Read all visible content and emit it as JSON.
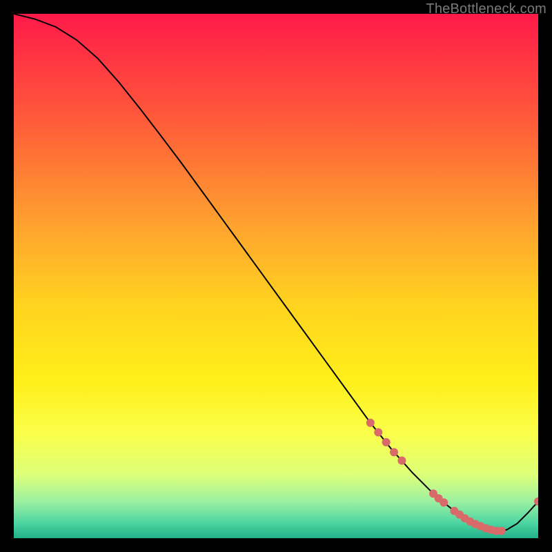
{
  "watermark": "TheBottleneck.com",
  "chart_data": {
    "type": "line",
    "title": "",
    "xlabel": "",
    "ylabel": "",
    "xlim": [
      0,
      100
    ],
    "ylim": [
      0,
      100
    ],
    "grid": false,
    "legend": false,
    "background_gradient": {
      "stops": [
        {
          "offset": 0.0,
          "color": "#ff1a49"
        },
        {
          "offset": 0.2,
          "color": "#ff5a3a"
        },
        {
          "offset": 0.4,
          "color": "#ffa12e"
        },
        {
          "offset": 0.55,
          "color": "#ffd21f"
        },
        {
          "offset": 0.7,
          "color": "#ffef1a"
        },
        {
          "offset": 0.8,
          "color": "#fbff4a"
        },
        {
          "offset": 0.88,
          "color": "#dcff7a"
        },
        {
          "offset": 0.93,
          "color": "#9cf0a0"
        },
        {
          "offset": 0.97,
          "color": "#4fd6a2"
        },
        {
          "offset": 1.0,
          "color": "#21b08a"
        }
      ]
    },
    "series": [
      {
        "name": "bottleneck-curve",
        "color": "#000000",
        "x": [
          0,
          4,
          8,
          12,
          16,
          20,
          24,
          28,
          32,
          36,
          40,
          44,
          48,
          52,
          56,
          60,
          64,
          68,
          72,
          76,
          80,
          82,
          84,
          86,
          88,
          90,
          92,
          94,
          96,
          98,
          100
        ],
        "y": [
          100,
          99,
          97.5,
          95,
          91.5,
          87,
          82,
          76.8,
          71.5,
          66,
          60.5,
          55,
          49.5,
          44,
          38.5,
          33,
          27.5,
          22,
          17,
          12.5,
          8.5,
          6.8,
          5.2,
          3.8,
          2.7,
          1.9,
          1.4,
          1.6,
          2.8,
          4.8,
          7
        ]
      }
    ],
    "points": {
      "name": "highlight-dots",
      "color": "#d96a6a",
      "coords": [
        {
          "x": 68,
          "y": 22.0
        },
        {
          "x": 69.5,
          "y": 20.2
        },
        {
          "x": 71,
          "y": 18.3
        },
        {
          "x": 72.5,
          "y": 16.4
        },
        {
          "x": 74,
          "y": 14.8
        },
        {
          "x": 80,
          "y": 8.5
        },
        {
          "x": 81,
          "y": 7.6
        },
        {
          "x": 82,
          "y": 6.8
        },
        {
          "x": 84,
          "y": 5.2
        },
        {
          "x": 85,
          "y": 4.5
        },
        {
          "x": 86,
          "y": 3.8
        },
        {
          "x": 87,
          "y": 3.2
        },
        {
          "x": 88,
          "y": 2.7
        },
        {
          "x": 89,
          "y": 2.3
        },
        {
          "x": 90,
          "y": 1.9
        },
        {
          "x": 91,
          "y": 1.6
        },
        {
          "x": 92,
          "y": 1.4
        },
        {
          "x": 93,
          "y": 1.4
        },
        {
          "x": 100,
          "y": 7.0
        }
      ]
    }
  }
}
